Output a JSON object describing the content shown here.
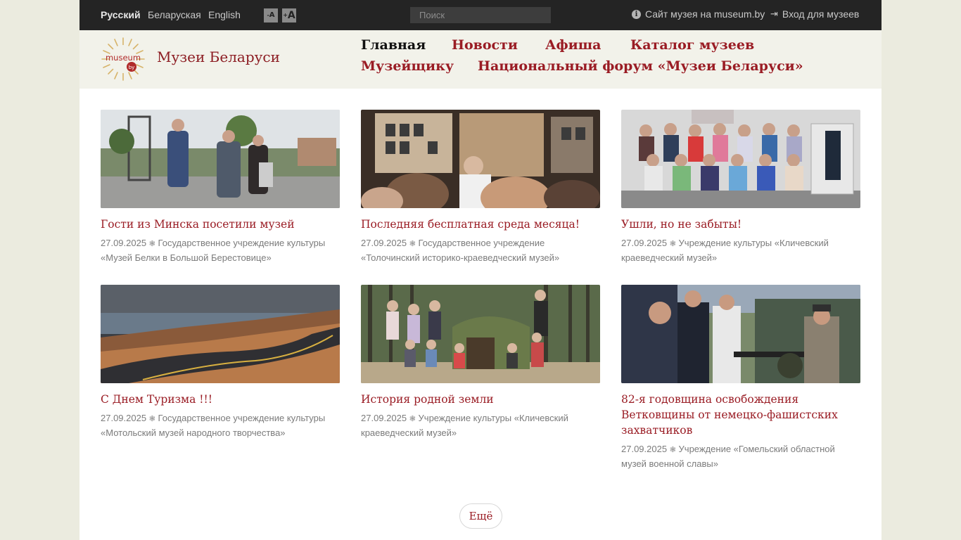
{
  "topbar": {
    "languages": [
      {
        "label": "Русский",
        "active": true
      },
      {
        "label": "Беларуская",
        "active": false
      },
      {
        "label": "English",
        "active": false
      }
    ],
    "font_buttons": [
      "A",
      "A"
    ],
    "search_placeholder": "Поиск",
    "museum_site_link": "Сайт музея на museum.by",
    "login_link": "Вход для музеев"
  },
  "header": {
    "logo_text": "museum",
    "logo_badge": "by",
    "site_title": "Музеи Беларуси",
    "nav": [
      {
        "label": "Главная",
        "active": true
      },
      {
        "label": "Новости",
        "active": false
      },
      {
        "label": "Афиша",
        "active": false
      },
      {
        "label": "Каталог музеев",
        "active": false
      },
      {
        "label": "Музейщику",
        "active": false
      },
      {
        "label": "Национальный форум «Музеи Беларуси»",
        "active": false
      }
    ]
  },
  "news": [
    {
      "title": "Гости из Минска посетили музей",
      "date": "27.09.2025",
      "org": "Государственное учреждение культуры «Музей Белки в Большой Берестовице»"
    },
    {
      "title": "Последняя бесплатная среда месяца!",
      "date": "27.09.2025",
      "org": "Государственное учреждение «Толочинский историко-краеведческий музей»"
    },
    {
      "title": "Ушли, но не забыты!",
      "date": "27.09.2025",
      "org": "Учреждение культуры «Кличевский краеведческий музей»"
    },
    {
      "title": "С Днем Туризма !!!",
      "date": "27.09.2025",
      "org": "Государственное учреждение культуры «Мотольский музей народного творчества»"
    },
    {
      "title": "История родной земли",
      "date": "27.09.2025",
      "org": "Учреждение культуры «Кличевский краеведческий музей»"
    },
    {
      "title": "82-я годовщина освобождения Ветковщины от немецко-фашистских захватчиков",
      "date": "27.09.2025",
      "org": "Учреждение «Гомельский областной музей военной славы»"
    }
  ],
  "more_button": "Ещё",
  "meta_separator": "❃",
  "colors": {
    "accent": "#9a1c24",
    "topbar": "#242424",
    "header_bg": "#f2f2ea",
    "page_bg": "#ebebdf"
  }
}
